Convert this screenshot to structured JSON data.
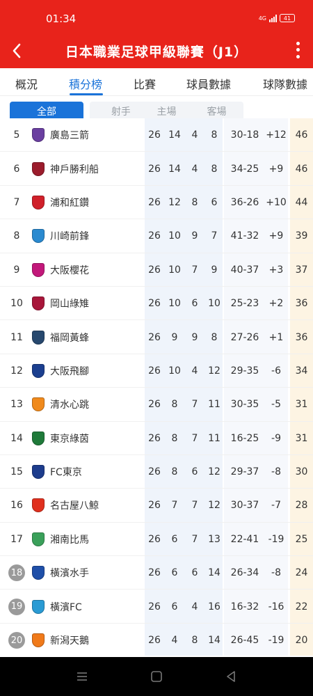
{
  "status_bar": {
    "time": "01:34",
    "network_label": "4G",
    "battery": "41"
  },
  "header": {
    "title": "日本職業足球甲級聯賽（J1）"
  },
  "tabs": [
    {
      "label": "概況",
      "active": false
    },
    {
      "label": "積分榜",
      "active": true
    },
    {
      "label": "比賽",
      "active": false
    },
    {
      "label": "球員數據",
      "active": false
    },
    {
      "label": "球隊數據",
      "active": false
    }
  ],
  "filters": [
    {
      "label": "全部",
      "active": true
    },
    {
      "label": "射手榜",
      "active": false
    },
    {
      "label": "主場",
      "active": false
    },
    {
      "label": "客場",
      "active": false
    }
  ],
  "standings": [
    {
      "rank": "5",
      "team": "廣島三箭",
      "played": "26",
      "won": "14",
      "drawn": "4",
      "lost": "8",
      "goals": "30-18",
      "gd": "+12",
      "pts": "46",
      "logo_color": "#6a3fa0"
    },
    {
      "rank": "6",
      "team": "神戶勝利船",
      "played": "26",
      "won": "14",
      "drawn": "4",
      "lost": "8",
      "goals": "34-25",
      "gd": "+9",
      "pts": "46",
      "logo_color": "#9b1c2c"
    },
    {
      "rank": "7",
      "team": "浦和紅鑽",
      "played": "26",
      "won": "12",
      "drawn": "8",
      "lost": "6",
      "goals": "36-26",
      "gd": "+10",
      "pts": "44",
      "logo_color": "#d0202a"
    },
    {
      "rank": "8",
      "team": "川崎前鋒",
      "played": "26",
      "won": "10",
      "drawn": "9",
      "lost": "7",
      "goals": "41-32",
      "gd": "+9",
      "pts": "39",
      "logo_color": "#2a8ad0"
    },
    {
      "rank": "9",
      "team": "大阪櫻花",
      "played": "26",
      "won": "10",
      "drawn": "7",
      "lost": "9",
      "goals": "40-37",
      "gd": "+3",
      "pts": "37",
      "logo_color": "#c2187a"
    },
    {
      "rank": "10",
      "team": "岡山綠雉",
      "played": "26",
      "won": "10",
      "drawn": "6",
      "lost": "10",
      "goals": "25-23",
      "gd": "+2",
      "pts": "36",
      "logo_color": "#a8163a"
    },
    {
      "rank": "11",
      "team": "福岡黃蜂",
      "played": "26",
      "won": "9",
      "drawn": "9",
      "lost": "8",
      "goals": "27-26",
      "gd": "+1",
      "pts": "36",
      "logo_color": "#27486e"
    },
    {
      "rank": "12",
      "team": "大阪飛腳",
      "played": "26",
      "won": "10",
      "drawn": "4",
      "lost": "12",
      "goals": "29-35",
      "gd": "-6",
      "pts": "34",
      "logo_color": "#1b3f8f"
    },
    {
      "rank": "13",
      "team": "清水心跳",
      "played": "26",
      "won": "8",
      "drawn": "7",
      "lost": "11",
      "goals": "30-35",
      "gd": "-5",
      "pts": "31",
      "logo_color": "#f08a1c"
    },
    {
      "rank": "14",
      "team": "東京綠茵",
      "played": "26",
      "won": "8",
      "drawn": "7",
      "lost": "11",
      "goals": "16-25",
      "gd": "-9",
      "pts": "31",
      "logo_color": "#1f7a3a"
    },
    {
      "rank": "15",
      "team": "FC東京",
      "played": "26",
      "won": "8",
      "drawn": "6",
      "lost": "12",
      "goals": "29-37",
      "gd": "-8",
      "pts": "30",
      "logo_color": "#1d3c8c"
    },
    {
      "rank": "16",
      "team": "名古屋八鯨",
      "played": "26",
      "won": "7",
      "drawn": "7",
      "lost": "12",
      "goals": "30-37",
      "gd": "-7",
      "pts": "28",
      "logo_color": "#e0301e"
    },
    {
      "rank": "17",
      "team": "湘南比馬",
      "played": "26",
      "won": "6",
      "drawn": "7",
      "lost": "13",
      "goals": "22-41",
      "gd": "-19",
      "pts": "25",
      "logo_color": "#3aa05a"
    },
    {
      "rank": "18",
      "team": "橫濱水手",
      "played": "26",
      "won": "6",
      "drawn": "6",
      "lost": "14",
      "goals": "26-34",
      "gd": "-8",
      "pts": "24",
      "logo_color": "#1f4fa8",
      "relegation": true
    },
    {
      "rank": "19",
      "team": "橫濱FC",
      "played": "26",
      "won": "6",
      "drawn": "4",
      "lost": "16",
      "goals": "16-32",
      "gd": "-16",
      "pts": "22",
      "logo_color": "#2a9bd4",
      "relegation": true
    },
    {
      "rank": "20",
      "team": "新潟天鵝",
      "played": "26",
      "won": "4",
      "drawn": "8",
      "lost": "14",
      "goals": "26-45",
      "gd": "-19",
      "pts": "20",
      "logo_color": "#f07a1a",
      "relegation": true
    }
  ],
  "icons": {
    "back": "chevron-left-icon",
    "more": "more-vertical-icon",
    "nav_menu": "menu-icon",
    "nav_home": "home-square-icon",
    "nav_back": "back-triangle-icon"
  },
  "colors": {
    "brand_red": "#e8231b",
    "accent_blue": "#1a73d9",
    "relegation_circle": "#9a9a9a",
    "points_column": "#fdf4e3"
  }
}
